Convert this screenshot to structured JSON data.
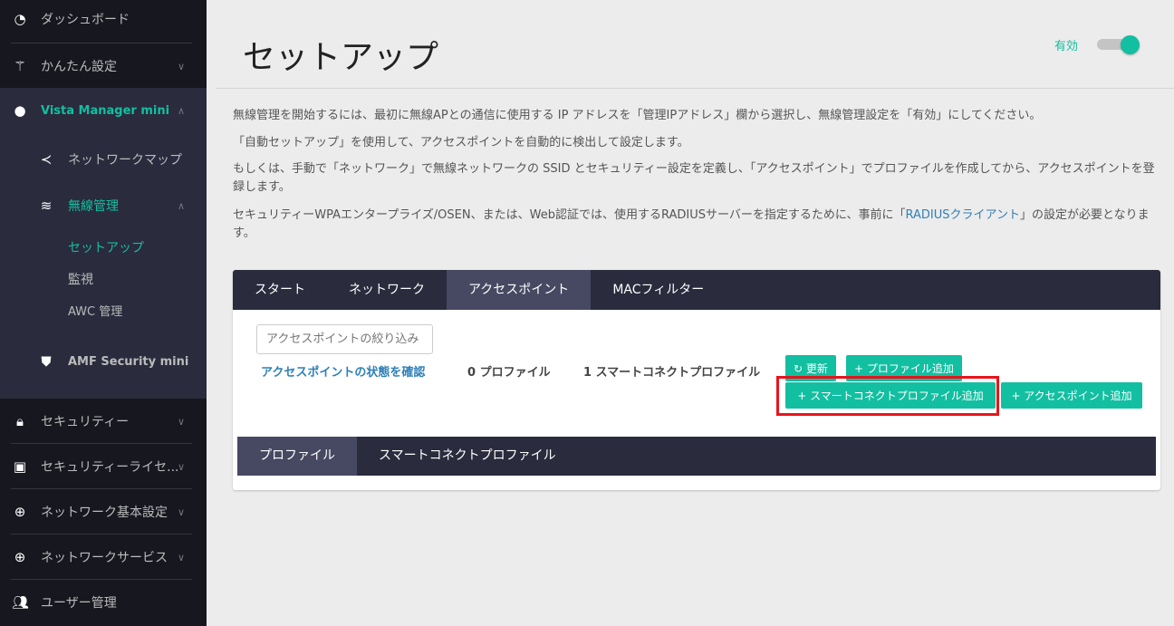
{
  "sidebar": {
    "items": [
      {
        "label": "ダッシュボード",
        "icon": "dashboard-icon"
      },
      {
        "label": "かんたん設定",
        "icon": "magic-wand-icon"
      },
      {
        "label": "Vista Manager mini",
        "icon": "globe-icon"
      },
      {
        "label": "ネットワークマップ",
        "icon": "share-icon"
      },
      {
        "label": "無線管理",
        "icon": "wifi-icon"
      },
      {
        "label": "セットアップ"
      },
      {
        "label": "監視"
      },
      {
        "label": "AWC 管理"
      },
      {
        "label": "AMF Security mini",
        "icon": "shield-icon"
      },
      {
        "label": "セキュリティー",
        "icon": "lock-icon"
      },
      {
        "label": "セキュリティーライセ...",
        "icon": "wallet-icon"
      },
      {
        "label": "ネットワーク基本設定",
        "icon": "globe-grid-icon"
      },
      {
        "label": "ネットワークサービス",
        "icon": "globe-grid-icon"
      },
      {
        "label": "ユーザー管理",
        "icon": "users-icon"
      }
    ]
  },
  "header": {
    "title": "セットアップ",
    "toggle_label": "有効",
    "toggle_on": true
  },
  "desc": {
    "p1": "無線管理を開始するには、最初に無線APとの通信に使用する IP アドレスを「管理IPアドレス」欄から選択し、無線管理設定を「有効」にしてください。",
    "p2": "「自動セットアップ」を使用して、アクセスポイントを自動的に検出して設定します。",
    "p3": "もしくは、手動で「ネットワーク」で無線ネットワークの SSID とセキュリティー設定を定義し、「アクセスポイント」でプロファイルを作成してから、アクセスポイントを登録します。",
    "p4a": "セキュリティーWPAエンタープライズ/OSEN、または、Web認証では、使用するRADIUSサーバーを指定するために、事前に「",
    "p4link": "RADIUSクライアント",
    "p4b": "」の設定が必要となります。"
  },
  "tabs": [
    "スタート",
    "ネットワーク",
    "アクセスポイント",
    "MACフィルター"
  ],
  "panel": {
    "filter_placeholder": "アクセスポイントの絞り込み",
    "status_link": "アクセスポイントの状態を確認",
    "profile_count": "0 プロファイル",
    "smart_count": "1 スマートコネクトプロファイル",
    "refresh": "更新",
    "add_profile": "プロファイル追加",
    "add_smart": "スマートコネクトプロファイル追加",
    "add_ap": "アクセスポイント追加"
  },
  "inner_tabs": [
    "プロファイル",
    "スマートコネクトプロファイル"
  ]
}
